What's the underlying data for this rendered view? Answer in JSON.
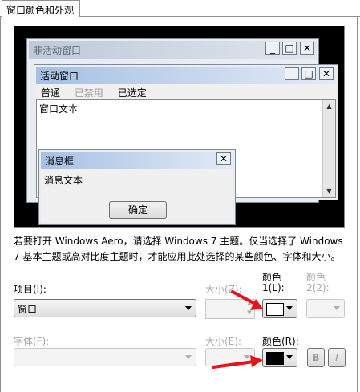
{
  "tab": {
    "label": "窗口颜色和外观"
  },
  "preview": {
    "inactive_window": {
      "title": "非活动窗口"
    },
    "active_window": {
      "title": "活动窗口",
      "menu": [
        {
          "label": "普通",
          "state": "normal"
        },
        {
          "label": "已禁用",
          "state": "disabled"
        },
        {
          "label": "已选定",
          "state": "selected"
        }
      ],
      "text": "窗口文本"
    },
    "message_box": {
      "title": "消息框",
      "text": "消息文本",
      "ok_label": "确定"
    },
    "controls": {
      "minimize": "_",
      "maximize": "□",
      "close": "✕"
    }
  },
  "description": "若要打开 Windows Aero，请选择 Windows 7 主题。仅当选择了 Windows 7 基本主题或高对比度主题时，才能应用此处选择的某些颜色、字体和大小。",
  "item": {
    "label": "项目(I):",
    "value": "窗口"
  },
  "size1": {
    "label": "大小(Z):",
    "value": ""
  },
  "color1": {
    "label_top": "颜色",
    "label_bottom": "1(L):",
    "swatch": "#ffffff"
  },
  "color2": {
    "label_top": "颜色",
    "label_bottom": "2(2):"
  },
  "font": {
    "label": "字体(F):",
    "value": ""
  },
  "size2": {
    "label": "大小(E):",
    "value": ""
  },
  "font_color": {
    "label": "颜色(R):",
    "swatch": "#000000"
  },
  "bold": {
    "label": "B"
  },
  "italic": {
    "label": "I"
  },
  "colors": {
    "annotation_arrow": "#e8111c"
  }
}
